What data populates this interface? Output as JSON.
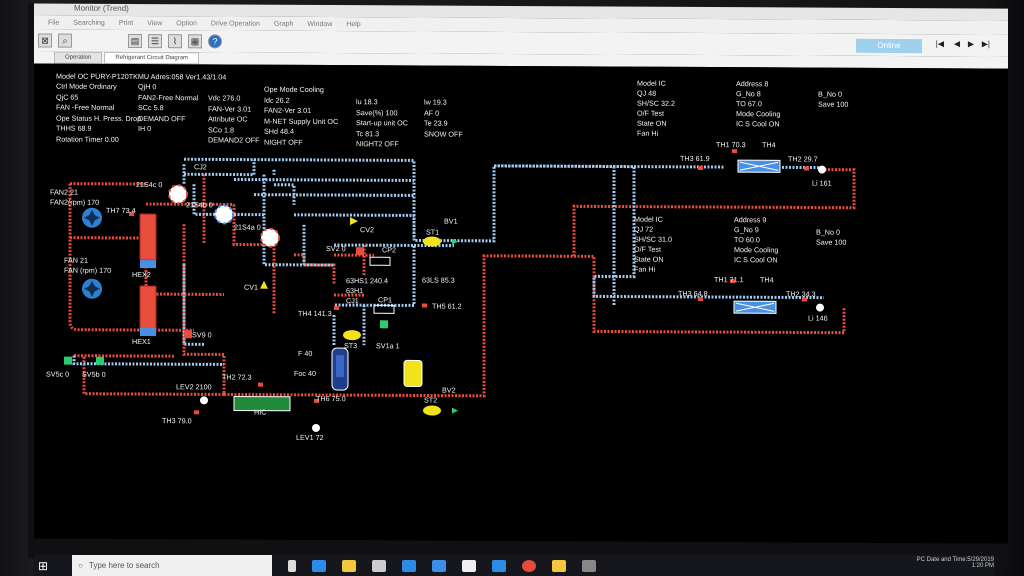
{
  "window": {
    "title": "Monitor (Trend)"
  },
  "menu": [
    "File",
    "Searching",
    "Print",
    "View",
    "Option",
    "Drive Operation",
    "Graph",
    "Window",
    "Help"
  ],
  "tabs": [
    "Operation",
    "Refrigerant Circuit Diagram"
  ],
  "status": {
    "online": "Online",
    "nav": [
      "|◀",
      "◀",
      "▶",
      "▶|"
    ]
  },
  "outdoor": {
    "model": "Model OC PURY-P120TKMU Adres:058 Ver1.43/1.04",
    "col1": [
      "Ctrl Mode Ordinary",
      "QjC 65",
      "FAN -Free Normal",
      "Ope Status H. Press. Drop",
      "",
      "THHS  68.9",
      "Rotation Timer  0.00"
    ],
    "col2": [
      "",
      "QjH 0",
      "FAN2-Free Normal",
      "",
      "SCc  5.8",
      "DEMAND OFF",
      "IH 0"
    ],
    "col3": [
      "Vdc 276.0",
      "FAN-Ver  3.01",
      "Attribute OC",
      "SCo  1.8",
      "DEMAND2 OFF"
    ],
    "col4": [
      "Ope Mode Cooling",
      "Idc  26.2",
      "FAN2-Ver  3.01",
      "M-NET Supply Unit OC",
      "SHd  48.4",
      "NIGHT OFF"
    ],
    "col5": [
      "lu  18.3",
      "Save(%) 100",
      "Start-up unit OC",
      "Tc  81.3",
      "NIGHT2 OFF"
    ],
    "col6": [
      "lw  19.3",
      "",
      "AF 0",
      "Te  23.9",
      "SNOW OFF"
    ]
  },
  "ic8": {
    "left": [
      "Model IC",
      "QJ 48",
      "SH/SC  32.2",
      "O/F Test",
      "State ON",
      "Fan Hi"
    ],
    "mid": [
      "Address 8",
      "G_No 8",
      "TO  67.0",
      "Mode Cooling",
      "IC S Cool ON"
    ],
    "right": [
      "B_No 0",
      "Save 100"
    ],
    "th1": "TH1  70.3",
    "th4": "TH4",
    "th3": "TH3  61.9",
    "th2": "TH2  29.7",
    "li": "Li  161"
  },
  "ic9": {
    "left": [
      "Model IC",
      "QJ 72",
      "SH/SC  31.0",
      "O/F Test",
      "State ON",
      "Fan Hi"
    ],
    "mid": [
      "Address 9",
      "G_No 9",
      "TO  60.0",
      "Mode Cooling",
      "IC S Cool ON"
    ],
    "right": [
      "B_No 0",
      "Save 100"
    ],
    "th1": "TH1  71.1",
    "th4": "TH4",
    "th3": "TH3  64.8",
    "th2": "TH2  34.3",
    "li": "Li  146"
  },
  "labels": {
    "fan2": "FAN2 21",
    "fan2rpm": "FAN2(rpm)   170",
    "th7": "TH7  73.4",
    "fan": "FAN 21",
    "fanrpm": "FAN (rpm)   170",
    "hex2": "HEX2",
    "hex1": "HEX1",
    "s21s4c": "21S4c 0",
    "s21s4b": "21S4b 0",
    "s21s4a": "21S4a 0",
    "cj2": "CJ2",
    "cv2": "CV2",
    "sv2": "SV2 0",
    "cp2": "CP2",
    "cv1": "CV1",
    "h63hs1": "63HS1  240.4",
    "h63h1": "63H1",
    "cj1": "CJ1",
    "th4": "TH4  141.3",
    "st3": "ST3",
    "sv1a": "SV1a 1",
    "cp1": "CP1",
    "s63ls": "63LS  85.3",
    "th5": "TH5  61.2",
    "bv1": "BV1",
    "st1": "ST1",
    "sv9": "SV9 0",
    "f": "F  40",
    "foc": "Foc  40",
    "sv5c": "SV5c 0",
    "sv5b": "SV5b 0",
    "lev2": "LEV2 2100",
    "th2": "TH2  72.3",
    "hic": "HIC",
    "th6": "TH6  75.0",
    "th3": "TH3  79.0",
    "lev1": "LEV1  72",
    "st2": "ST2",
    "bv2": "BV2"
  },
  "taskbar": {
    "search": "Type here to search",
    "clock": "PC Date and Time:5/29/2019",
    "time": "1:20 PM"
  },
  "colors": {
    "hot": "#e84c3d",
    "cold": "#9fc9ee",
    "hex": "#4a90e2",
    "valve": "#f2e21c"
  }
}
